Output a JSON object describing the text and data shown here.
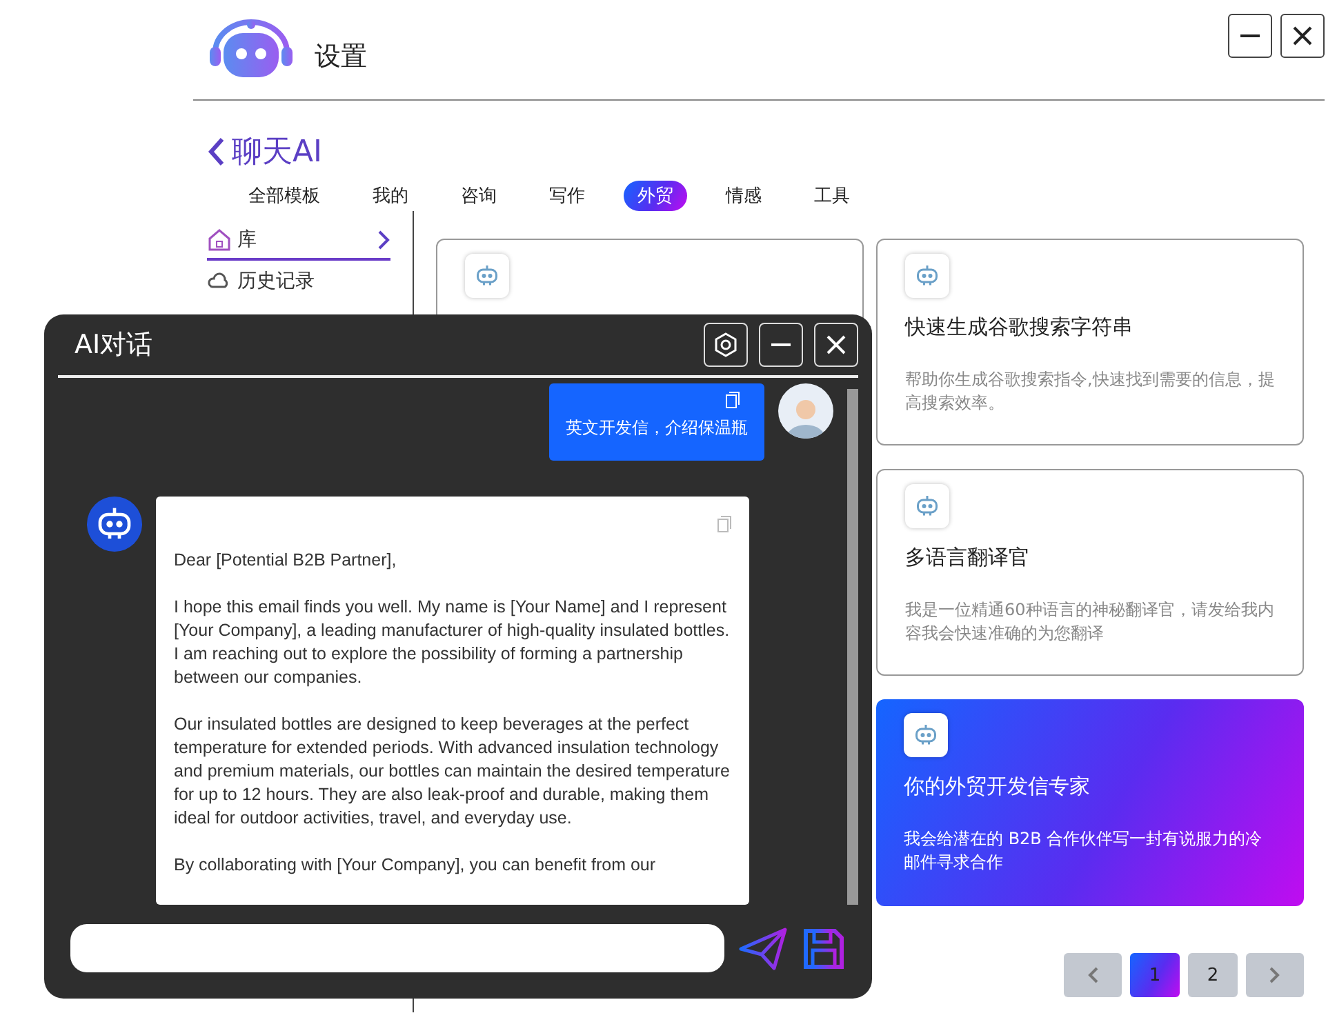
{
  "window": {
    "title": "设置"
  },
  "header": {
    "back_title": "聊天AI"
  },
  "tabs": [
    {
      "label": "全部模板",
      "selected": false
    },
    {
      "label": "我的",
      "selected": false
    },
    {
      "label": "咨询",
      "selected": false
    },
    {
      "label": "写作",
      "selected": false
    },
    {
      "label": "外贸",
      "selected": true
    },
    {
      "label": "情感",
      "selected": false
    },
    {
      "label": "工具",
      "selected": false
    }
  ],
  "sidebar": {
    "items": [
      {
        "label": "库",
        "selected": true
      },
      {
        "label": "历史记录",
        "selected": false
      }
    ]
  },
  "cards": [
    {
      "selected": false
    },
    {
      "title": "快速生成谷歌搜索字符串",
      "description": "帮助你生成谷歌搜索指令,快速找到需要的信息，提高搜索效率。",
      "selected": false
    },
    {
      "title": "多语言翻译官",
      "description": "我是一位精通60种语言的神秘翻译官，请发给我内容我会快速准确的为您翻译",
      "selected": false
    },
    {
      "title": "你的外贸开发信专家",
      "description": "我会给潜在的 B2B 合作伙伴写一封有说服力的冷邮件寻求合作",
      "selected": true
    }
  ],
  "pagination": [
    {
      "label": "1",
      "selected": true
    },
    {
      "label": "2",
      "selected": false
    }
  ],
  "chat": {
    "title": "AI对话",
    "messages": [
      {
        "kind": "user",
        "text": "英文开发信，介绍保温瓶"
      },
      {
        "kind": "bot",
        "paragraphs": [
          "Dear [Potential B2B Partner],",
          "I hope this email finds you well. My name is [Your Name] and I represent [Your Company], a leading manufacturer of high-quality insulated bottles. I am reaching out to explore the possibility of forming a partnership between our companies.",
          "Our insulated bottles are designed to keep beverages at the perfect temperature for extended periods. With advanced insulation technology and premium materials, our bottles can maintain the desired temperature for up to 12 hours. They are also leak-proof and durable, making them ideal for outdoor activities, travel, and everyday use.",
          "By collaborating with [Your Company], you can benefit from our"
        ]
      }
    ]
  }
}
